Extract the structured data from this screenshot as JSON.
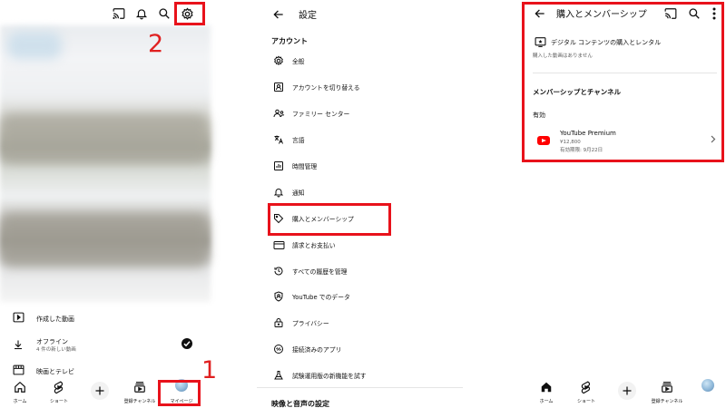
{
  "panel1": {
    "step_labels": {
      "one": "1",
      "two": "2"
    },
    "list": [
      {
        "label": "作成した動画",
        "sub": ""
      },
      {
        "label": "オフライン",
        "sub": "4 件の新しい動画"
      },
      {
        "label": "映画とテレビ",
        "sub": ""
      }
    ],
    "nav": {
      "home": "ホーム",
      "shorts": "ショート",
      "subs": "登録チャンネル",
      "mypage": "マイページ"
    }
  },
  "panel2": {
    "title": "設定",
    "section_account": "アカウント",
    "items": [
      {
        "label": "全般",
        "icon": "gear-icon"
      },
      {
        "label": "アカウントを切り替える",
        "icon": "switch-account-icon"
      },
      {
        "label": "ファミリー センター",
        "icon": "family-icon"
      },
      {
        "label": "言語",
        "icon": "translate-icon"
      },
      {
        "label": "時間管理",
        "icon": "bar-chart-icon"
      },
      {
        "label": "通知",
        "icon": "bell-icon"
      },
      {
        "label": "購入とメンバーシップ",
        "icon": "tag-icon"
      },
      {
        "label": "請求とお支払い",
        "icon": "credit-card-icon"
      },
      {
        "label": "すべての履歴を管理",
        "icon": "history-icon"
      },
      {
        "label": "YouTube でのデータ",
        "icon": "shield-person-icon"
      },
      {
        "label": "プライバシー",
        "icon": "lock-icon"
      },
      {
        "label": "接続済みのアプリ",
        "icon": "link-icon"
      },
      {
        "label": "試験運用版の新機能を試す",
        "icon": "flask-icon"
      }
    ],
    "section_video": "映像と音声の設定"
  },
  "panel3": {
    "title": "購入とメンバーシップ",
    "digital_label": "デジタル コンテンツの購入とレンタル",
    "digital_sub": "購入した動画はありません",
    "section_membership": "メンバーシップとチャンネル",
    "active_label": "有効",
    "premium_name": "YouTube Premium",
    "premium_price": "¥12,800",
    "premium_expiry": "有効期限: 9月22日",
    "nav": {
      "home": "ホーム",
      "shorts": "ショート",
      "subs": "登録チャンネル",
      "mypage": ""
    }
  },
  "colors": {
    "highlight_red": "#e8121b",
    "step_number_red": "#e02020",
    "youtube_red": "#ff0000"
  }
}
